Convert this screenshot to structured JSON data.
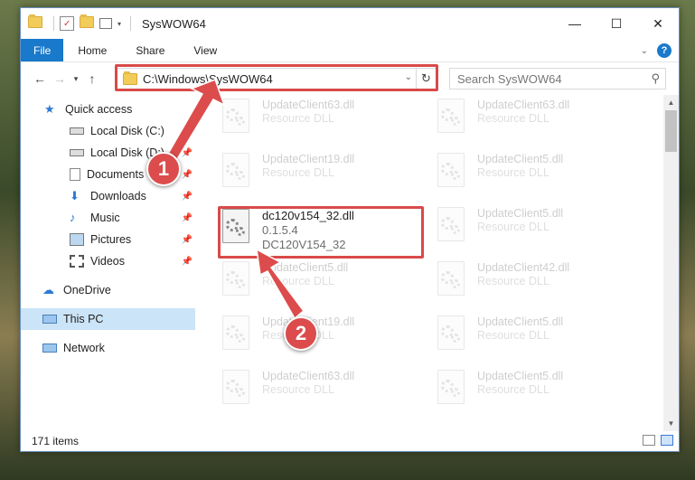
{
  "window": {
    "title": "SysWOW64",
    "controls": {
      "minimize": "—",
      "maximize": "☐",
      "close": "✕"
    }
  },
  "ribbon": {
    "tabs": [
      "File",
      "Home",
      "Share",
      "View"
    ],
    "help": "?"
  },
  "address": {
    "path": "C:\\Windows\\SysWOW64",
    "search_placeholder": "Search SysWOW64"
  },
  "nav": {
    "quick_access": "Quick access",
    "items": [
      "Local Disk (C:)",
      "Local Disk (D:)",
      "Documents",
      "Downloads",
      "Music",
      "Pictures",
      "Videos"
    ],
    "onedrive": "OneDrive",
    "this_pc": "This PC",
    "network": "Network"
  },
  "files": {
    "left": [
      {
        "name": "UpdateClient63.dll",
        "sub": "Resource DLL"
      },
      {
        "name": "UpdateClient19.dll",
        "sub": "Resource DLL"
      },
      {
        "name": "UpdateClient5.dll",
        "sub": "Resource DLL"
      },
      {
        "name": "UpdateClient19.dll",
        "sub": "Resource DLL"
      },
      {
        "name": "UpdateClient63.dll",
        "sub": "Resource DLL"
      }
    ],
    "right": [
      {
        "name": "UpdateClient63.dll",
        "sub": "Resource DLL"
      },
      {
        "name": "UpdateClient5.dll",
        "sub": "Resource DLL"
      },
      {
        "name": "UpdateClient5.dll",
        "sub": "Resource DLL"
      },
      {
        "name": "UpdateClient42.dll",
        "sub": "Resource DLL"
      },
      {
        "name": "UpdateClient5.dll",
        "sub": "Resource DLL"
      },
      {
        "name": "UpdateClient5.dll",
        "sub": "Resource DLL"
      }
    ],
    "target": {
      "name": "dc120v154_32.dll",
      "version": "0.1.5.4",
      "description": "DC120V154_32"
    }
  },
  "status": {
    "count": "171 items"
  },
  "callouts": [
    "1",
    "2"
  ],
  "colors": {
    "accent": "#1979ca",
    "highlight": "#d94a4a",
    "selection": "#cce4f7"
  }
}
